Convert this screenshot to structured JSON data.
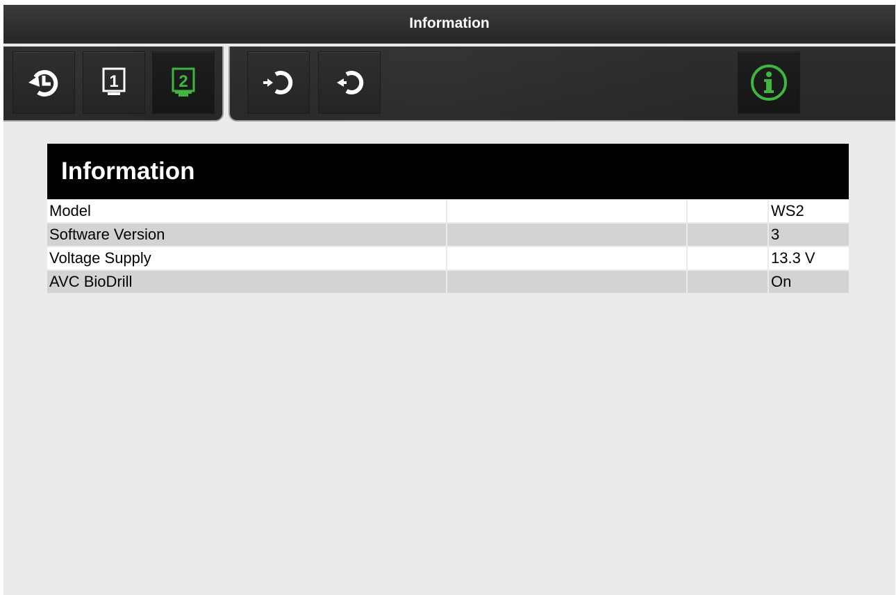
{
  "window": {
    "title": "Information"
  },
  "toolbar": {
    "buttons": [
      {
        "name": "history",
        "icon": "history-icon",
        "active": false
      },
      {
        "name": "monitor-1",
        "icon": "monitor-1-icon",
        "label": "1",
        "active": false
      },
      {
        "name": "monitor-2",
        "icon": "monitor-2-icon",
        "label": "2",
        "active": true
      },
      {
        "name": "restore-in",
        "icon": "restore-in-icon",
        "active": false
      },
      {
        "name": "restore-out",
        "icon": "restore-out-icon",
        "active": false
      },
      {
        "name": "info",
        "icon": "info-icon",
        "active": true
      }
    ]
  },
  "colors": {
    "accent": "#3fb63f",
    "title_bar": "#2e2e2e",
    "panel_header": "#000000",
    "row_alt": "#d3d3d3",
    "background": "#ecebe9"
  },
  "info": {
    "heading": "Information",
    "rows": [
      {
        "label": "Model",
        "col2": "",
        "col3": "",
        "value": "WS2"
      },
      {
        "label": "Software Version",
        "col2": "",
        "col3": "",
        "value": "3"
      },
      {
        "label": "Voltage Supply",
        "col2": "",
        "col3": "",
        "value": "13.3 V"
      },
      {
        "label": "AVC BioDrill",
        "col2": "",
        "col3": "",
        "value": "On"
      }
    ]
  }
}
